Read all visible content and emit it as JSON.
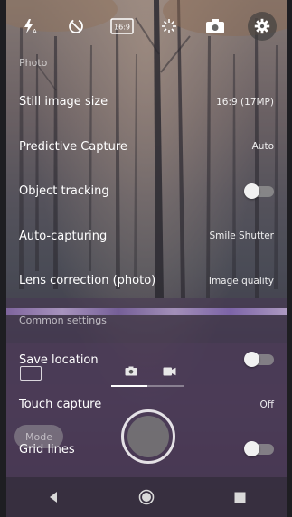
{
  "topbar": {
    "icons": [
      "flash-auto-icon",
      "timer-icon",
      "aspect-ratio-icon",
      "white-balance-icon",
      "switch-camera-icon",
      "settings-gear-icon"
    ],
    "aspect_label": "16:9"
  },
  "sections": {
    "photo_header": "Photo",
    "common_header": "Common settings"
  },
  "rows": {
    "still_image_size": {
      "label": "Still image size",
      "value": "16:9 (17MP)"
    },
    "predictive_capture": {
      "label": "Predictive Capture",
      "value": "Auto"
    },
    "object_tracking": {
      "label": "Object tracking",
      "toggle": "off"
    },
    "auto_capturing": {
      "label": "Auto-capturing",
      "value": "Smile Shutter"
    },
    "lens_correction": {
      "label": "Lens correction (photo)",
      "value": "Image quality"
    },
    "save_location": {
      "label": "Save location",
      "toggle": "off"
    },
    "touch_capture": {
      "label": "Touch capture",
      "value": "Off"
    },
    "grid_lines": {
      "label": "Grid lines",
      "toggle": "off"
    }
  },
  "camera": {
    "mode_label": "Mode"
  },
  "navbar": {
    "icons": [
      "back-icon",
      "home-icon",
      "recents-icon"
    ]
  }
}
